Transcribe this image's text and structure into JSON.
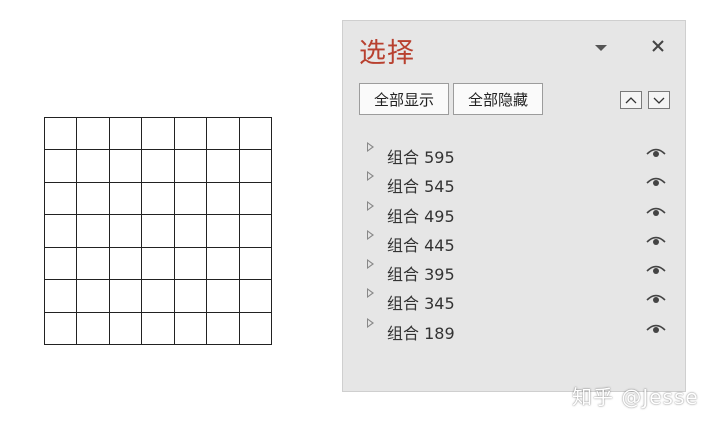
{
  "pane": {
    "title": "选择",
    "show_all_label": "全部显示",
    "hide_all_label": "全部隐藏",
    "items": [
      {
        "label": "组合 595"
      },
      {
        "label": "组合 545"
      },
      {
        "label": "组合 495"
      },
      {
        "label": "组合 445"
      },
      {
        "label": "组合 395"
      },
      {
        "label": "组合 345"
      },
      {
        "label": "组合 189"
      }
    ]
  },
  "watermark": "知乎 @Jesse",
  "colors": {
    "title": "#b8402f",
    "pane_bg": "#e6e6e6"
  },
  "icons": {
    "menu": "chevron-down-icon",
    "close": "close-icon",
    "move_up": "arrow-up-icon",
    "move_down": "arrow-down-icon",
    "expand": "expand-triangle-icon",
    "visibility": "eye-icon"
  }
}
